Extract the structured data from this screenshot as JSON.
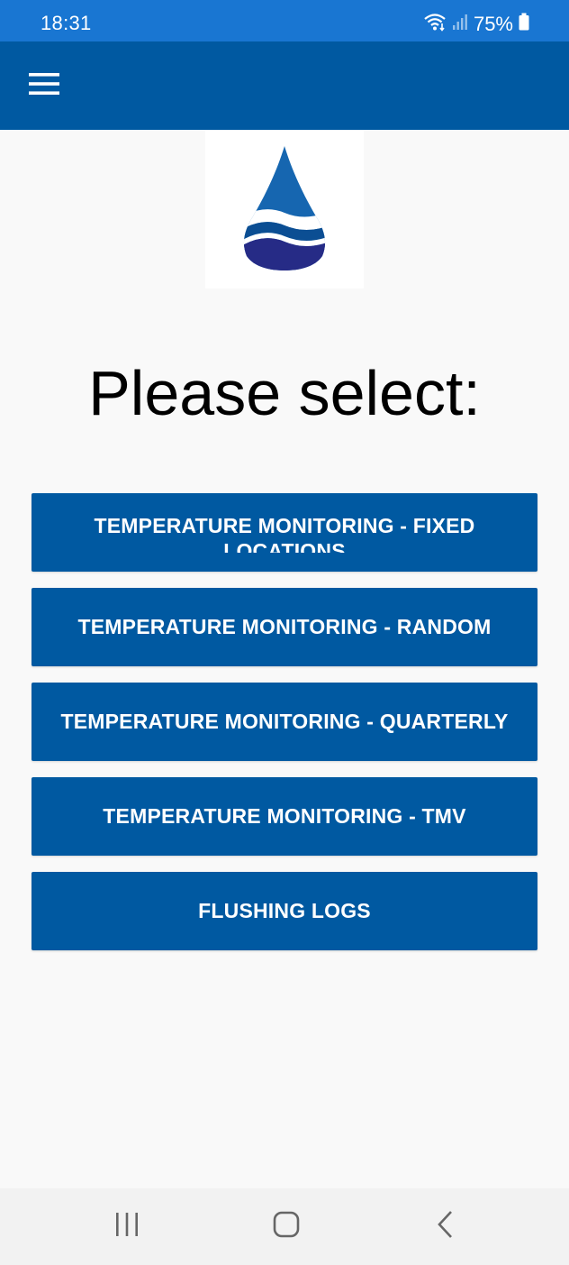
{
  "status_bar": {
    "time": "18:31",
    "battery": "75%",
    "icons": [
      "wifi-icon",
      "signal-icon",
      "battery-icon"
    ]
  },
  "app_bar": {
    "menu_icon": "hamburger-menu-icon",
    "color": "#0059a1"
  },
  "logo": {
    "icon": "water-drop-logo"
  },
  "main": {
    "heading": "Please select:",
    "buttons": [
      {
        "label": "TEMPERATURE MONITORING - FIXED LOCATIONS"
      },
      {
        "label": "TEMPERATURE MONITORING - RANDOM"
      },
      {
        "label": "TEMPERATURE MONITORING - QUARTERLY"
      },
      {
        "label": "TEMPERATURE MONITORING - TMV"
      },
      {
        "label": "FLUSHING LOGS"
      }
    ]
  },
  "nav_bar": {
    "icons": [
      "recent-apps-icon",
      "home-icon",
      "back-icon"
    ]
  },
  "colors": {
    "status_bar": "#1976d2",
    "primary": "#0059a1",
    "background": "#f9f9f9"
  }
}
